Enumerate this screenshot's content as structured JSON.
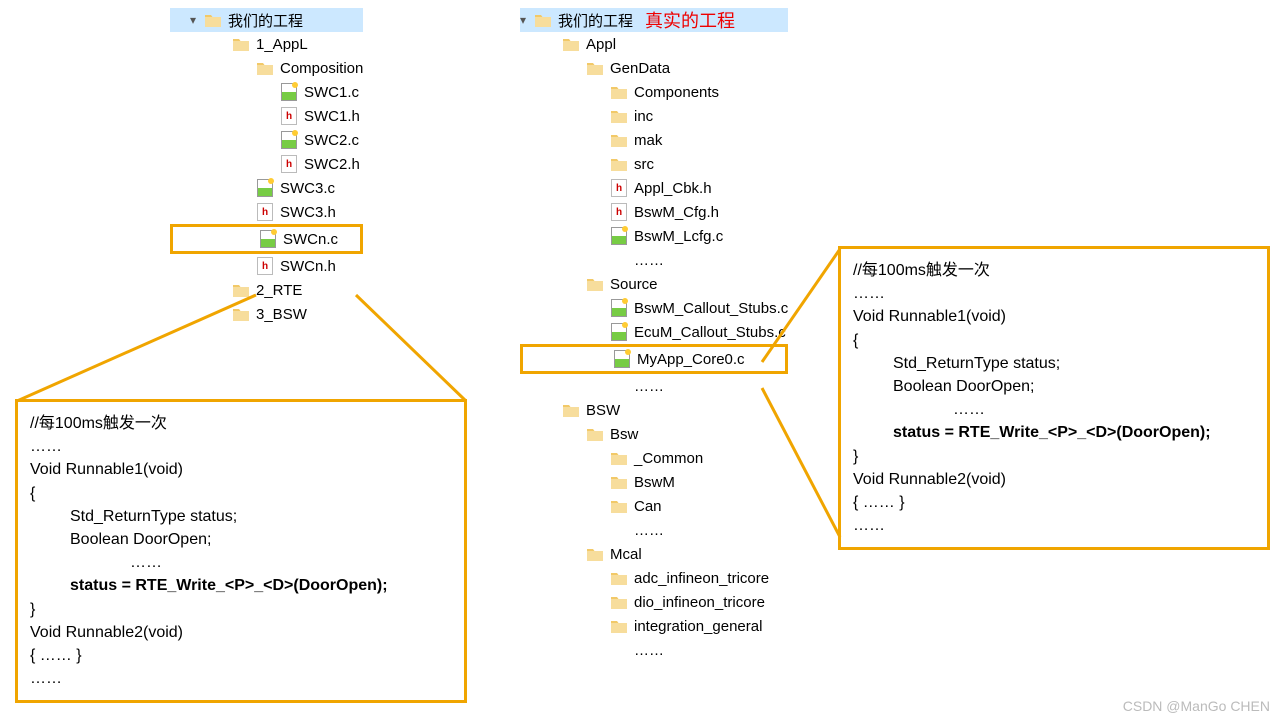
{
  "leftTree": {
    "root": {
      "label": "我们的工程"
    },
    "items": [
      {
        "label": "1_AppL",
        "icon": "folder",
        "indent": 1
      },
      {
        "label": "Composition",
        "icon": "folder",
        "indent": 2
      },
      {
        "label": "SWC1.c",
        "icon": "cfile",
        "indent": 3
      },
      {
        "label": "SWC1.h",
        "icon": "hfile",
        "indent": 3
      },
      {
        "label": "SWC2.c",
        "icon": "cfile",
        "indent": 3
      },
      {
        "label": "SWC2.h",
        "icon": "hfile",
        "indent": 3
      },
      {
        "label": "SWC3.c",
        "icon": "cfile",
        "indent": 2
      },
      {
        "label": "SWC3.h",
        "icon": "hfile",
        "indent": 2
      },
      {
        "label": "SWCn.c",
        "icon": "cfile",
        "indent": 2,
        "hl": true
      },
      {
        "label": "SWCn.h",
        "icon": "hfile",
        "indent": 2
      },
      {
        "label": "2_RTE",
        "icon": "folder",
        "indent": 1
      },
      {
        "label": "3_BSW",
        "icon": "folder",
        "indent": 1
      }
    ]
  },
  "rightTree": {
    "root": {
      "label": "我们的工程"
    },
    "redLabel": "真实的工程",
    "items": [
      {
        "label": "Appl",
        "icon": "folder",
        "indent": 1
      },
      {
        "label": "GenData",
        "icon": "folder",
        "indent": 2
      },
      {
        "label": "Components",
        "icon": "folder",
        "indent": 3
      },
      {
        "label": "inc",
        "icon": "folder",
        "indent": 3
      },
      {
        "label": "mak",
        "icon": "folder",
        "indent": 3
      },
      {
        "label": "src",
        "icon": "folder",
        "indent": 3
      },
      {
        "label": "Appl_Cbk.h",
        "icon": "hfile",
        "indent": 3
      },
      {
        "label": "BswM_Cfg.h",
        "icon": "hfile",
        "indent": 3
      },
      {
        "label": "BswM_Lcfg.c",
        "icon": "cfile",
        "indent": 3
      },
      {
        "label": "……",
        "icon": "none",
        "indent": 3
      },
      {
        "label": "Source",
        "icon": "folder",
        "indent": 2
      },
      {
        "label": "BswM_Callout_Stubs.c",
        "icon": "cfile",
        "indent": 3
      },
      {
        "label": "EcuM_Callout_Stubs.c",
        "icon": "cfile",
        "indent": 3
      },
      {
        "label": "MyApp_Core0.c",
        "icon": "cfile",
        "indent": 3,
        "hl": true
      },
      {
        "label": "……",
        "icon": "none",
        "indent": 3
      },
      {
        "label": "BSW",
        "icon": "folder",
        "indent": 1
      },
      {
        "label": "Bsw",
        "icon": "folder",
        "indent": 2
      },
      {
        "label": "_Common",
        "icon": "folder",
        "indent": 3
      },
      {
        "label": "BswM",
        "icon": "folder",
        "indent": 3
      },
      {
        "label": "Can",
        "icon": "folder",
        "indent": 3
      },
      {
        "label": "……",
        "icon": "none",
        "indent": 3
      },
      {
        "label": "Mcal",
        "icon": "folder",
        "indent": 2
      },
      {
        "label": "adc_infineon_tricore",
        "icon": "folder",
        "indent": 3
      },
      {
        "label": "dio_infineon_tricore",
        "icon": "folder",
        "indent": 3
      },
      {
        "label": "integration_general",
        "icon": "folder",
        "indent": 3
      },
      {
        "label": "……",
        "icon": "none",
        "indent": 3
      }
    ]
  },
  "code": {
    "line1": "//每100ms触发一次",
    "line2": "……",
    "line3": "Void Runnable1(void)",
    "line4": "{",
    "line5": "Std_ReturnType status;",
    "line6": "Boolean DoorOpen;",
    "line7": "……",
    "line8": "status = RTE_Write_<P>_<D>(DoorOpen);",
    "line9": "}",
    "line10": "Void Runnable2(void)",
    "line11": "{                ……                }",
    "line12": "……"
  },
  "watermark": "CSDN @ManGo CHEN"
}
